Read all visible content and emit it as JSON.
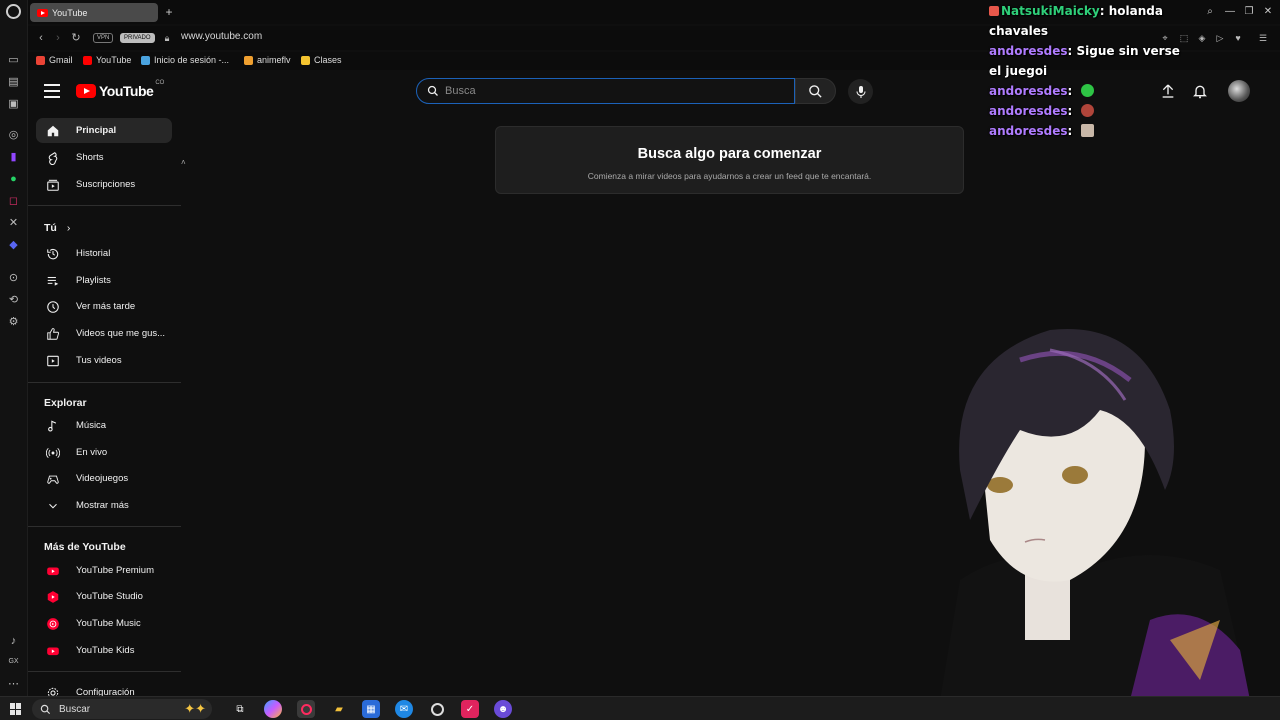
{
  "browser": {
    "tab_title": "YouTube",
    "vpn_label": "VPN",
    "private_label": "PRIVADO",
    "url": "www.youtube.com",
    "bookmarks": [
      {
        "label": "Gmail",
        "color": "#ea4335"
      },
      {
        "label": "YouTube",
        "color": "#ff0000"
      },
      {
        "label": "Inicio de sesión -...",
        "color": "#4aa3df"
      },
      {
        "label": "animeflv",
        "color": "#f0a030"
      },
      {
        "label": "Clases",
        "color": "#f4c430"
      }
    ]
  },
  "opera_rail": {
    "bottom_label": "GX"
  },
  "header": {
    "logo_text": "YouTube",
    "country_code": "CO",
    "search_placeholder": "Busca"
  },
  "sidebar": {
    "main": [
      {
        "label": "Principal",
        "icon": "home-icon",
        "active": true
      },
      {
        "label": "Shorts",
        "icon": "shorts-icon"
      },
      {
        "label": "Suscripciones",
        "icon": "subscriptions-icon"
      }
    ],
    "you_heading": "Tú",
    "you": [
      {
        "label": "Historial",
        "icon": "history-icon"
      },
      {
        "label": "Playlists",
        "icon": "playlists-icon"
      },
      {
        "label": "Ver más tarde",
        "icon": "clock-icon"
      },
      {
        "label": "Videos que me gus...",
        "icon": "thumbs-up-icon"
      },
      {
        "label": "Tus videos",
        "icon": "your-videos-icon"
      }
    ],
    "explore_heading": "Explorar",
    "explore": [
      {
        "label": "Música",
        "icon": "music-note-icon"
      },
      {
        "label": "En vivo",
        "icon": "live-icon"
      },
      {
        "label": "Videojuegos",
        "icon": "gamepad-icon"
      },
      {
        "label": "Mostrar más",
        "icon": "chevron-down-icon"
      }
    ],
    "more_heading": "Más de YouTube",
    "more": [
      {
        "label": "YouTube Premium",
        "icon": "youtube-premium-icon"
      },
      {
        "label": "YouTube Studio",
        "icon": "youtube-studio-icon"
      },
      {
        "label": "YouTube Music",
        "icon": "youtube-music-icon"
      },
      {
        "label": "YouTube Kids",
        "icon": "youtube-kids-icon"
      }
    ],
    "settings_label": "Configuración"
  },
  "main": {
    "card_title": "Busca algo para comenzar",
    "card_subtitle": "Comienza a mirar videos para ayudarnos a crear un feed que te encantará."
  },
  "chat": [
    {
      "user": "NatsukiMaicky",
      "color": "#2fd07a",
      "text": "holanda chavales",
      "badge": true
    },
    {
      "user": "andoresdes",
      "color": "#b07cff",
      "text": "Sigue sin verse el juegoi"
    },
    {
      "user": "andoresdes",
      "color": "#b07cff",
      "text": "",
      "emote_color": "#2ec445"
    },
    {
      "user": "andoresdes",
      "color": "#b07cff",
      "text": "",
      "emote_color": "#b0453a"
    },
    {
      "user": "andoresdes",
      "color": "#b07cff",
      "text": "",
      "emote_color": "#c9b8a8"
    }
  ],
  "taskbar": {
    "search_label": "Buscar"
  },
  "colors": {
    "background": "#0f0f0f",
    "accent_red": "#ff0000",
    "search_focus": "#1c62b9"
  }
}
